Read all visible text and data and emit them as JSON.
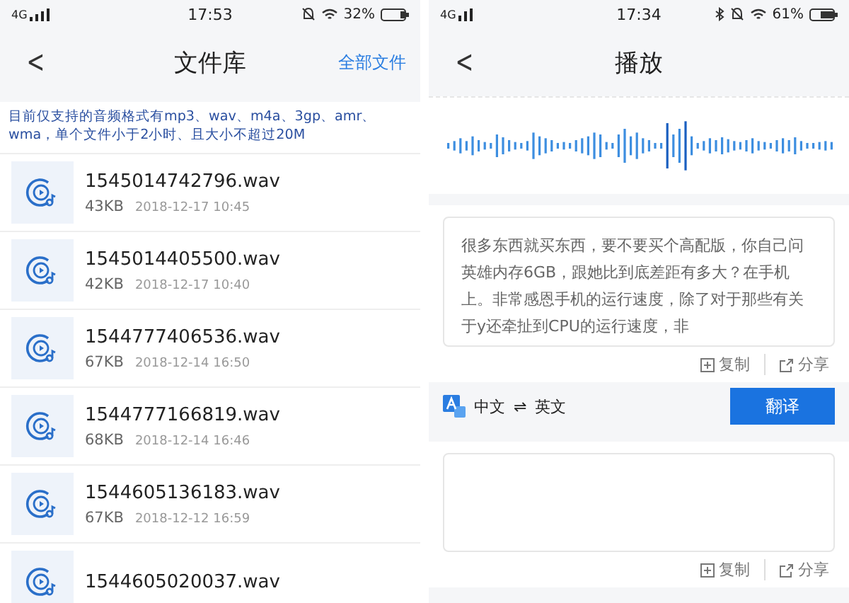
{
  "left_screen": {
    "status_bar": {
      "network": "4G",
      "time": "17:53",
      "battery": "32%"
    },
    "header": {
      "back": "<",
      "title": "文件库",
      "action": "全部文件"
    },
    "notice": "目前仅支持的音频格式有mp3、wav、m4a、3gp、amr、wma，单个文件小于2小时、且大小不超过20M",
    "files": [
      {
        "name": "1545014742796.wav",
        "size": "43KB",
        "date": "2018-12-17 10:45"
      },
      {
        "name": "1545014405500.wav",
        "size": "42KB",
        "date": "2018-12-17 10:40"
      },
      {
        "name": "1544777406536.wav",
        "size": "67KB",
        "date": "2018-12-14 16:50"
      },
      {
        "name": "1544777166819.wav",
        "size": "68KB",
        "date": "2018-12-14 16:46"
      },
      {
        "name": "1544605136183.wav",
        "size": "67KB",
        "date": "2018-12-12 16:59"
      },
      {
        "name": "1544605020037.wav"
      }
    ]
  },
  "right_screen": {
    "status_bar": {
      "network": "4G",
      "time": "17:34",
      "battery": "61%"
    },
    "header": {
      "back": "<",
      "title": "播放"
    },
    "transcript": {
      "text": "很多东西就买东西，要不要买个高配版，你自己问英雄内存6GB，跟她比到底差距有多大？在手机上。非常感恩手机的运行速度，除了对于那些有关于y还牵扯到CPU的运行速度，非",
      "actions": [
        "复制",
        "分享"
      ]
    },
    "translate": {
      "source": "中文",
      "swap": "⇌",
      "target": "英文",
      "button": "翻译"
    },
    "translation": {
      "actions": [
        "复制",
        "分享"
      ]
    }
  }
}
